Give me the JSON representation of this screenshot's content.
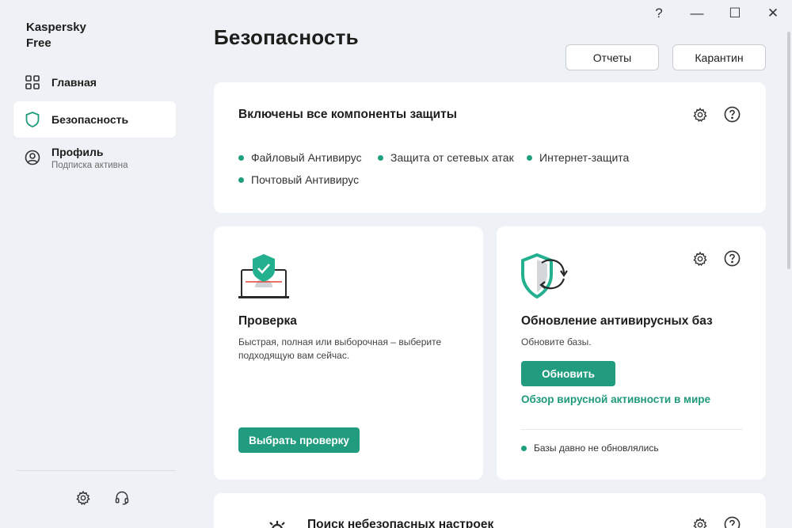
{
  "app": {
    "title": "Kaspersky\nFree"
  },
  "window": {
    "help": "?",
    "minimize": "—",
    "maximize": "☐",
    "close": "✕"
  },
  "sidebar": {
    "items": [
      {
        "label": "Главная",
        "icon": "grid-icon"
      },
      {
        "label": "Безопасность",
        "icon": "shield-icon",
        "active": true
      },
      {
        "label": "Профиль",
        "sub": "Подписка активна",
        "icon": "user-icon"
      }
    ],
    "bottom_icons": [
      "gear-icon",
      "headset-icon"
    ]
  },
  "header": {
    "title": "Безопасность",
    "reports_label": "Отчеты",
    "quarantine_label": "Карантин"
  },
  "protection_card": {
    "title": "Включены все компоненты защиты",
    "components": [
      "Файловый Антивирус",
      "Защита от сетевых атак",
      "Интернет-защита",
      "Почтовый Антивирус"
    ]
  },
  "scan_card": {
    "title": "Проверка",
    "description": "Быстрая, полная или выборочная – выберите подходящую вам сейчас.",
    "button_label": "Выбрать проверку"
  },
  "update_card": {
    "title": "Обновление антивирусных баз",
    "description": "Обновите базы.",
    "button_label": "Обновить",
    "link_label": "Обзор вирусной активности в мире",
    "status": "Базы давно не обновлялись"
  },
  "settings_card": {
    "title": "Поиск небезопасных настроек"
  },
  "colors": {
    "accent": "#219c7f",
    "status_dot": "#1f9f7d",
    "background": "#eef1f5"
  }
}
